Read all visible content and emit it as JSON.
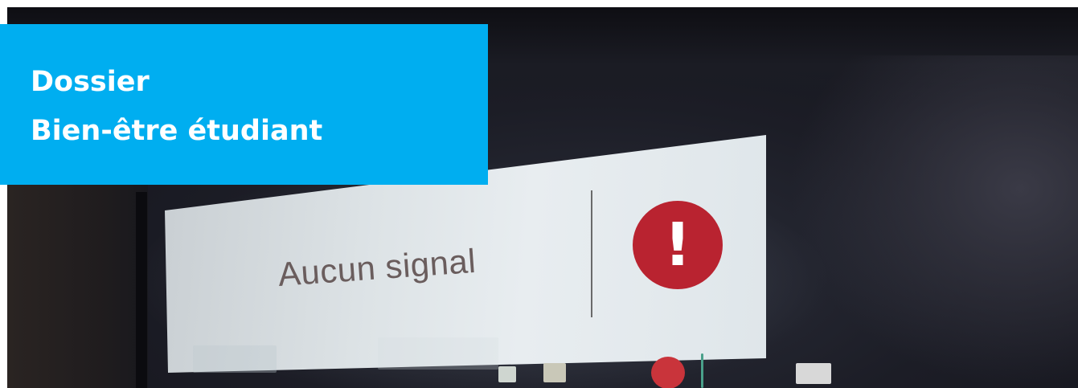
{
  "banner": {
    "line1": "Dossier",
    "line2": "Bien-être étudiant",
    "background_color": "#00aef0",
    "text_color": "#ffffff"
  },
  "screen": {
    "message": "Aucun signal",
    "icon": "exclamation-circle-icon",
    "icon_glyph": "!",
    "icon_color": "#b92330"
  }
}
